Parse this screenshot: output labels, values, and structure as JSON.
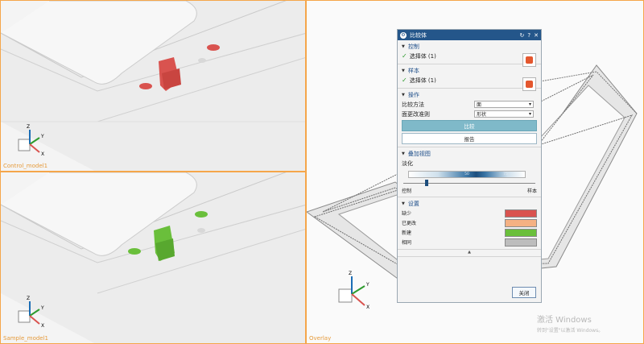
{
  "viewports": {
    "control_label": "Control_model1",
    "sample_label": "Sample_model1",
    "overlay_label": "Overlay"
  },
  "axes": {
    "x": "X",
    "y": "Y",
    "z": "Z"
  },
  "dialog": {
    "title": "比较体",
    "title_buttons": [
      "↻",
      "?",
      "✕"
    ],
    "control": {
      "header": "控制",
      "selection": "选择体 (1)"
    },
    "sample": {
      "header": "样本",
      "selection": "选择体 (1)"
    },
    "operation": {
      "header": "操作",
      "method_label": "比较方法",
      "method_value": "面",
      "rule_label": "面更改准则",
      "rule_value": "形状",
      "compare_button": "比较",
      "report_button": "报告"
    },
    "overlay_view": {
      "header": "叠加视图",
      "fade_label": "淡化",
      "slider_ticks": [
        "25",
        "50",
        "75"
      ],
      "slider_value": 0.17,
      "left_end": "控制",
      "right_end": "样本"
    },
    "settings": {
      "header": "设置",
      "items": [
        {
          "label": "缺少",
          "color": "#d9534f"
        },
        {
          "label": "已更改",
          "color": "#f5b183"
        },
        {
          "label": "新建",
          "color": "#6abf3b"
        },
        {
          "label": "相同",
          "color": "#bdbdbd"
        }
      ]
    },
    "close_button": "关闭"
  },
  "watermark": {
    "line1": "激活 Windows",
    "line2": "转到\"设置\"以激活 Windows。"
  }
}
